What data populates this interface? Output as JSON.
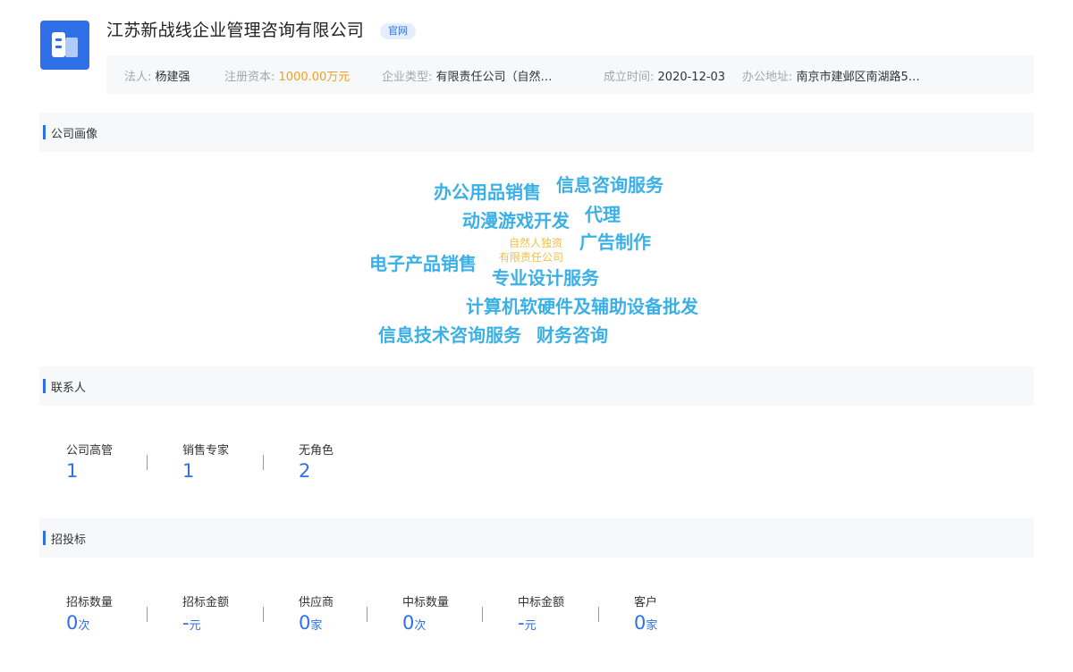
{
  "company": {
    "name": "江苏新战线企业管理咨询有限公司",
    "official_tag": "官网"
  },
  "info": {
    "legal_person": {
      "label": "法人:",
      "value": "杨建强"
    },
    "capital": {
      "label": "注册资本:",
      "value": "1000.00万元"
    },
    "company_type": {
      "label": "企业类型:",
      "value": "有限责任公司（自然…"
    },
    "founded": {
      "label": "成立时间:",
      "value": "2020-12-03"
    },
    "address": {
      "label": "办公地址:",
      "value": "南京市建邺区南湖路5…"
    }
  },
  "sections": {
    "portrait": "公司画像",
    "contacts": "联系人",
    "bidding": "招投标"
  },
  "word_cloud": {
    "words": [
      "办公用品销售",
      "信息咨询服务",
      "动漫游戏开发",
      "代理",
      "自然人独资",
      "广告制作",
      "电子产品销售",
      "有限责任公司",
      "专业设计服务",
      "计算机软硬件及辅助设备批发",
      "信息技术咨询服务",
      "财务咨询"
    ],
    "colors": {
      "primary": "#3ab0e6",
      "secondary": "#f0c04a"
    }
  },
  "contacts": [
    {
      "label": "公司高管",
      "value": "1"
    },
    {
      "label": "销售专家",
      "value": "1"
    },
    {
      "label": "无角色",
      "value": "2"
    }
  ],
  "bidding": [
    {
      "label": "招标数量",
      "value": "0",
      "unit": "次"
    },
    {
      "label": "招标金额",
      "value": "-",
      "unit": "元"
    },
    {
      "label": "供应商",
      "value": "0",
      "unit": "家"
    },
    {
      "label": "中标数量",
      "value": "0",
      "unit": "次"
    },
    {
      "label": "中标金额",
      "value": "-",
      "unit": "元"
    },
    {
      "label": "客户",
      "value": "0",
      "unit": "家"
    }
  ],
  "theme": {
    "accent": "#2f6fe8",
    "orange": "#f0a022",
    "section_bg": "#f7f8fa"
  }
}
